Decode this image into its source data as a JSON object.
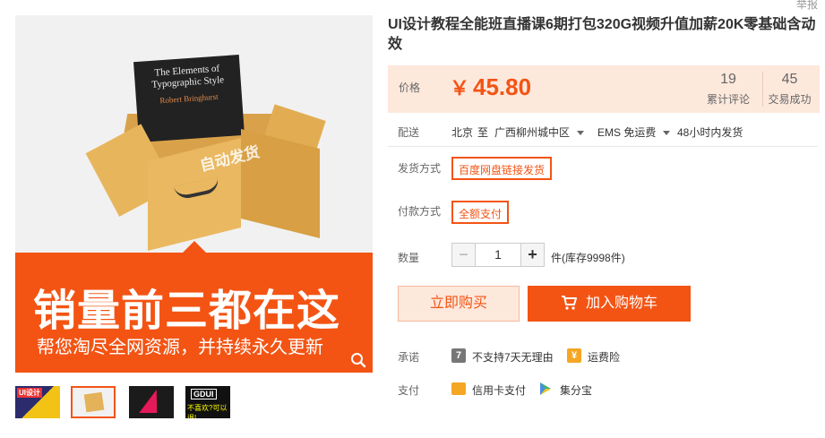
{
  "report_link": "举报",
  "gallery": {
    "promo_title": "销量前三都在这",
    "promo_sub": "帮您淘尽全网资源，并持续永久更新",
    "box_label": "自动发货",
    "book_title": "The Elements of Typographic Style",
    "book_author": "Robert Bringhurst",
    "thumbs": [
      {
        "text": "UI设计"
      },
      {
        "text": ""
      },
      {
        "text": ""
      },
      {
        "text": "GDUI",
        "text2": "不喜欢?可以退!"
      }
    ]
  },
  "product": {
    "title": "UI设计教程全能班直播课6期打包320G视频升值加薪20K零基础含动效",
    "price_label": "价格",
    "currency": "￥",
    "price": "45.80",
    "reviews_count": "19",
    "reviews_label": "累计评论",
    "sales_count": "45",
    "sales_label": "交易成功"
  },
  "delivery": {
    "label": "配送",
    "origin": "北京",
    "to": "至",
    "destination": "广西柳州城中区",
    "shipping": "EMS 免运费",
    "dispatch": "48小时内发货"
  },
  "options": {
    "ship_method_label": "发货方式",
    "ship_method_value": "百度网盘链接发货",
    "pay_method_label": "付款方式",
    "pay_method_value": "全额支付"
  },
  "quantity": {
    "label": "数量",
    "minus": "−",
    "value": "1",
    "plus": "+",
    "stock": "件(库存9998件)"
  },
  "actions": {
    "buy_now": "立即购买",
    "add_to_cart": "加入购物车"
  },
  "promise": {
    "label": "承诺",
    "no_return_icon": "7",
    "no_return": "不支持7天无理由",
    "shipping_insurance": "运费险"
  },
  "payment": {
    "label": "支付",
    "credit_card": "信用卡支付",
    "jifenbao": "集分宝"
  },
  "colors": {
    "accent": "#f35414",
    "price_bg": "#fde8dc"
  }
}
